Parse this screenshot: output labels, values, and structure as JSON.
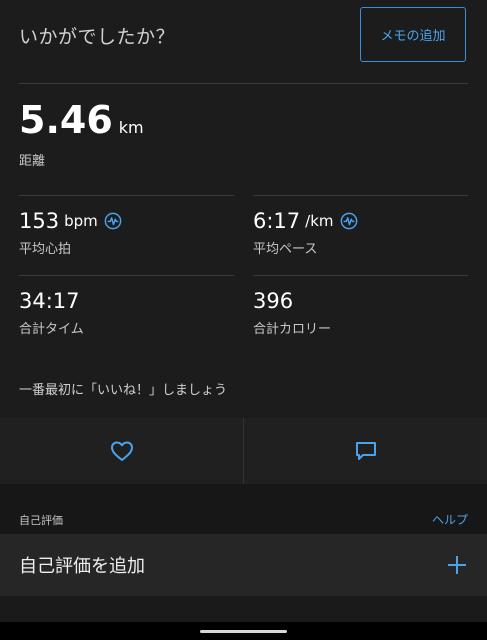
{
  "header": {
    "question": "いかがでしたか？",
    "memo_button": "メモの追加"
  },
  "distance": {
    "value": "5.46",
    "unit": "km",
    "label": "距離"
  },
  "stats": {
    "heart_rate": {
      "value": "153",
      "unit": "bpm",
      "label": "平均心拍"
    },
    "pace": {
      "value": "6:17",
      "unit": "/km",
      "label": "平均ペース"
    },
    "time": {
      "value": "34:17",
      "label": "合計タイム"
    },
    "calories": {
      "value": "396",
      "label": "合計カロリー"
    }
  },
  "social": {
    "like_prompt": "一番最初に「いいね！」しましょう"
  },
  "self_eval": {
    "section_label": "自己評価",
    "help_link": "ヘルプ",
    "add_label": "自己評価を追加"
  },
  "colors": {
    "accent": "#4aa3ee",
    "background": "#1c1c1c"
  }
}
